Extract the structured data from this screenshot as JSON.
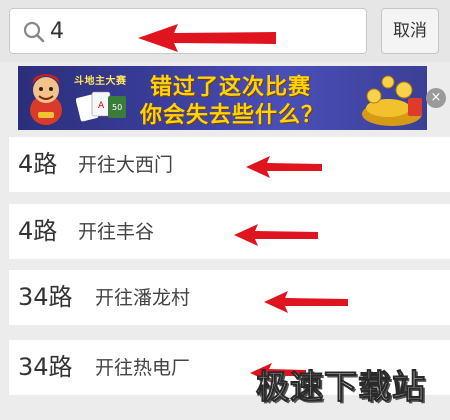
{
  "search": {
    "query": "4",
    "cancel_label": "取消"
  },
  "banner": {
    "game_name": "斗地主大赛",
    "line1": "错过了这次比赛",
    "line2": "你会失去些什么？",
    "close_label": "×"
  },
  "results": [
    {
      "route": "4路",
      "destination": "开往大西门"
    },
    {
      "route": "4路",
      "destination": "开往丰谷"
    },
    {
      "route": "34路",
      "destination": "开往潘龙村"
    },
    {
      "route": "34路",
      "destination": "开往热电厂"
    }
  ],
  "watermark": {
    "text": "极速下载站"
  },
  "colors": {
    "arrow": "#e0141e",
    "banner_text": "#ffd400",
    "background": "#ececec"
  }
}
